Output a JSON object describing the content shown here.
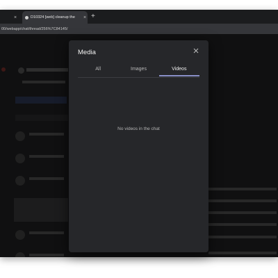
{
  "browser": {
    "tabs": [
      {
        "title": "",
        "active": false
      },
      {
        "title": "D10324 [web] cleanup the",
        "active": true
      }
    ],
    "tab_close_glyph": "×",
    "new_tab_glyph": "+",
    "address": "00/webapp/chat/thread/256%7C84145/"
  },
  "modal": {
    "title": "Media",
    "tabs": [
      "All",
      "Images",
      "Videos"
    ],
    "active_tab": "Videos",
    "empty_message": "No videos in the chat"
  },
  "colors": {
    "modal_bg": "#26272a",
    "active_tab_underline": "#8a90c9",
    "page_bg": "#2a2a2d"
  },
  "icons": {
    "close": "close-icon",
    "favicon": "favicon-icon"
  }
}
